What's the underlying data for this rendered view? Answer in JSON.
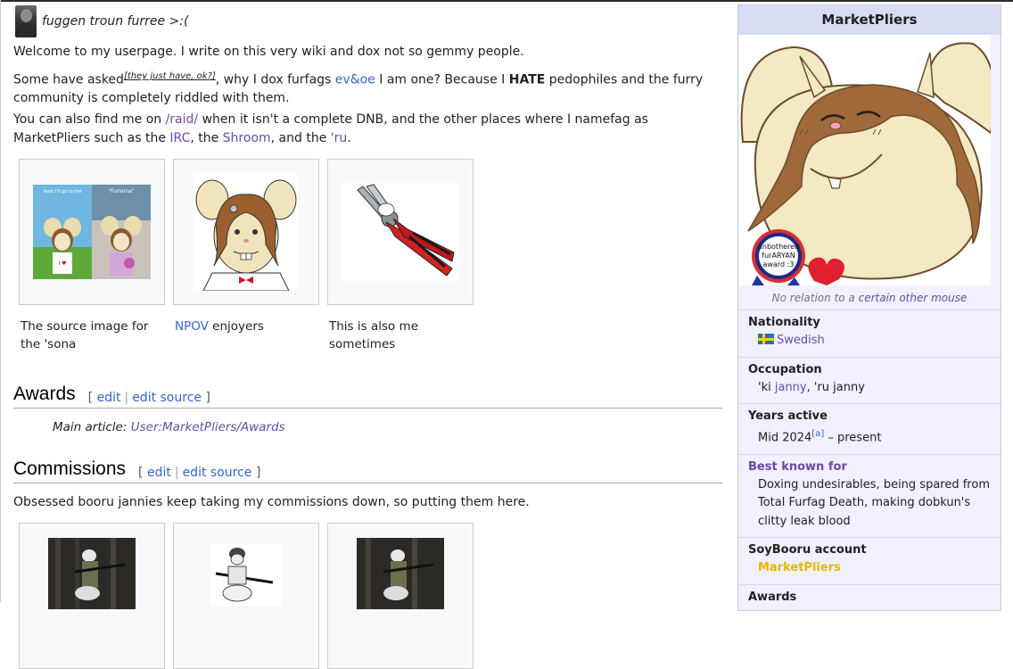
{
  "header": {
    "text": "fuggen troun furree >:("
  },
  "intro": {
    "p1": "Welcome to my userpage. I write on this very wiki and dox not so gemmy people.",
    "p2_a": "Some have asked",
    "p2_note": "[they just have, ok?]",
    "p2_b": ", why I dox furfags ",
    "p2_link": "ev&oe",
    "p2_c": " I am one? Because I ",
    "p2_bold": "HATE",
    "p2_d": " pedophiles and the furry community is completely riddled with them.",
    "p3_a": "You can also find me on ",
    "p3_raid": "/raid/",
    "p3_b": " when it isn't a complete DNB, and the other places where I namefag as MarketPliers such as the ",
    "p3_irc": "IRC",
    "p3_c": ", the ",
    "p3_shroom": "Shroom",
    "p3_d": ", and the ",
    "p3_ru": "'ru",
    "p3_e": "."
  },
  "gallery1": {
    "cap1": "The source image for the 'sona",
    "cap2_link": "NPOV",
    "cap2_rest": " enjoyers",
    "cap3": "This is also me sometimes",
    "img1_text_left": "Yeah I'll go to the / with you, lookin for / trained against the / pseudo-psychoanalytic / and hilariously / ...",
    "img1_text_right": "\"Fursona\""
  },
  "awards": {
    "title": "Awards",
    "open_bracket": "[",
    "edit": "edit",
    "sep": "|",
    "edit_source": "edit source",
    "close_bracket": "]",
    "main_article_label": "Main article: ",
    "main_article_link": "User:MarketPliers/Awards"
  },
  "commissions": {
    "title": "Commissions",
    "open_bracket": "[",
    "edit": "edit",
    "sep": "|",
    "edit_source": "edit source",
    "close_bracket": "]",
    "text": "Obsessed booru jannies keep taking my commissions down, so putting them here."
  },
  "infobox": {
    "title": "MarketPliers",
    "badge_line1": "unbothered",
    "badge_line2": "furARYAN",
    "badge_line3": "award :3",
    "caption_a": "No relation to a ",
    "caption_link": "certain other mouse",
    "nationality_label": "Nationality",
    "nationality_value": "Swedish",
    "occupation_label": "Occupation",
    "occupation_a": "'ki ",
    "occupation_link": "janny",
    "occupation_b": ", 'ru janny",
    "years_label": "Years active",
    "years_a": "Mid 2024",
    "years_note": "[a]",
    "years_b": " – present",
    "known_label": "Best known for",
    "known_value": "Doxing undesirables, being spared from Total Furfag Death, making dobkun's clitty leak blood",
    "soybooru_label": "SoyBooru account",
    "soybooru_value": "MarketPliers",
    "next_label": "Awards"
  },
  "colors": {
    "link": "#3366cc",
    "visited": "#6b4ba1",
    "infobox_bg": "#f0f0ff",
    "infobox_title_bg": "#d8dcf2",
    "booru_yellow": "#e6b800"
  }
}
